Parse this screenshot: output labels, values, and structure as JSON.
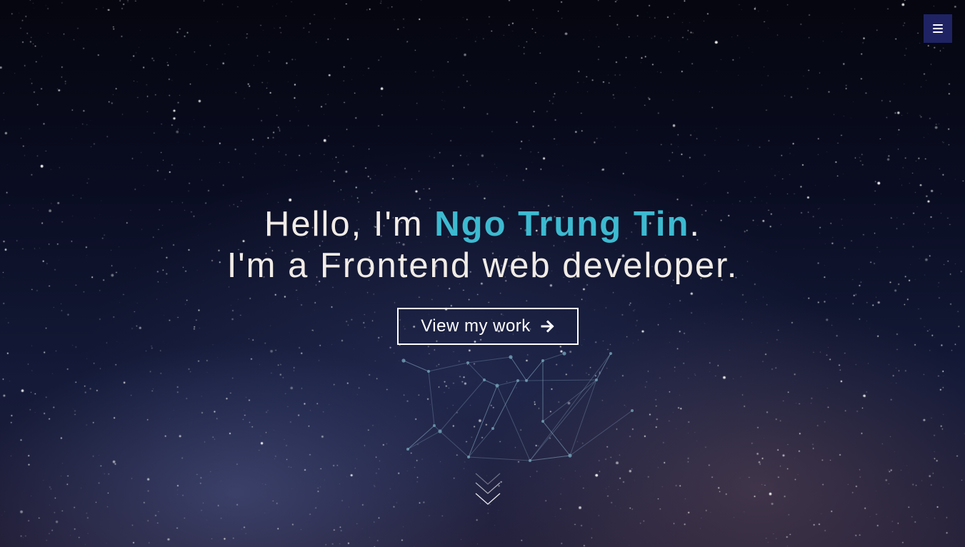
{
  "hero": {
    "greeting_prefix": "Hello, I'm ",
    "name": "Ngo Trung Tin",
    "greeting_suffix": ".",
    "subtitle": "I'm a Frontend web developer.",
    "cta_label": "View my work",
    "cta_icon": "arrow-right-icon",
    "scroll_icon": "double-chevron-down-icon"
  },
  "menu": {
    "icon": "hamburger-menu-icon"
  },
  "colors": {
    "highlight": "#3dbad0",
    "menu_button_bg": "#1f2363",
    "text": "#f1ece6"
  }
}
